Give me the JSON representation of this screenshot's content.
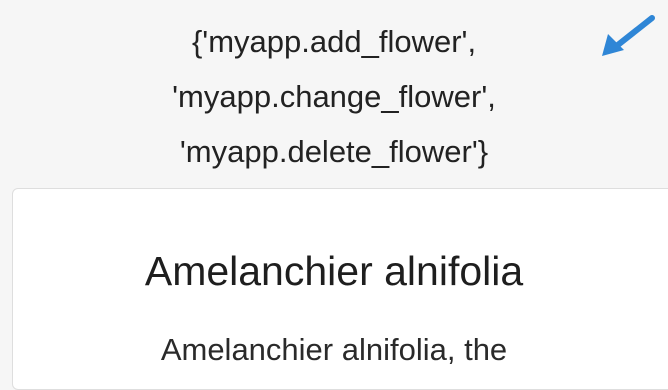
{
  "permissions": {
    "line1": "{'myapp.add_flower',",
    "line2": "'myapp.change_flower',",
    "line3": "'myapp.delete_flower'}"
  },
  "pointer": {
    "icon": "arrow-pointer-icon",
    "color": "#2f86d6"
  },
  "card": {
    "title": "Amelanchier alnifolia",
    "text": "Amelanchier alnifolia, the"
  }
}
